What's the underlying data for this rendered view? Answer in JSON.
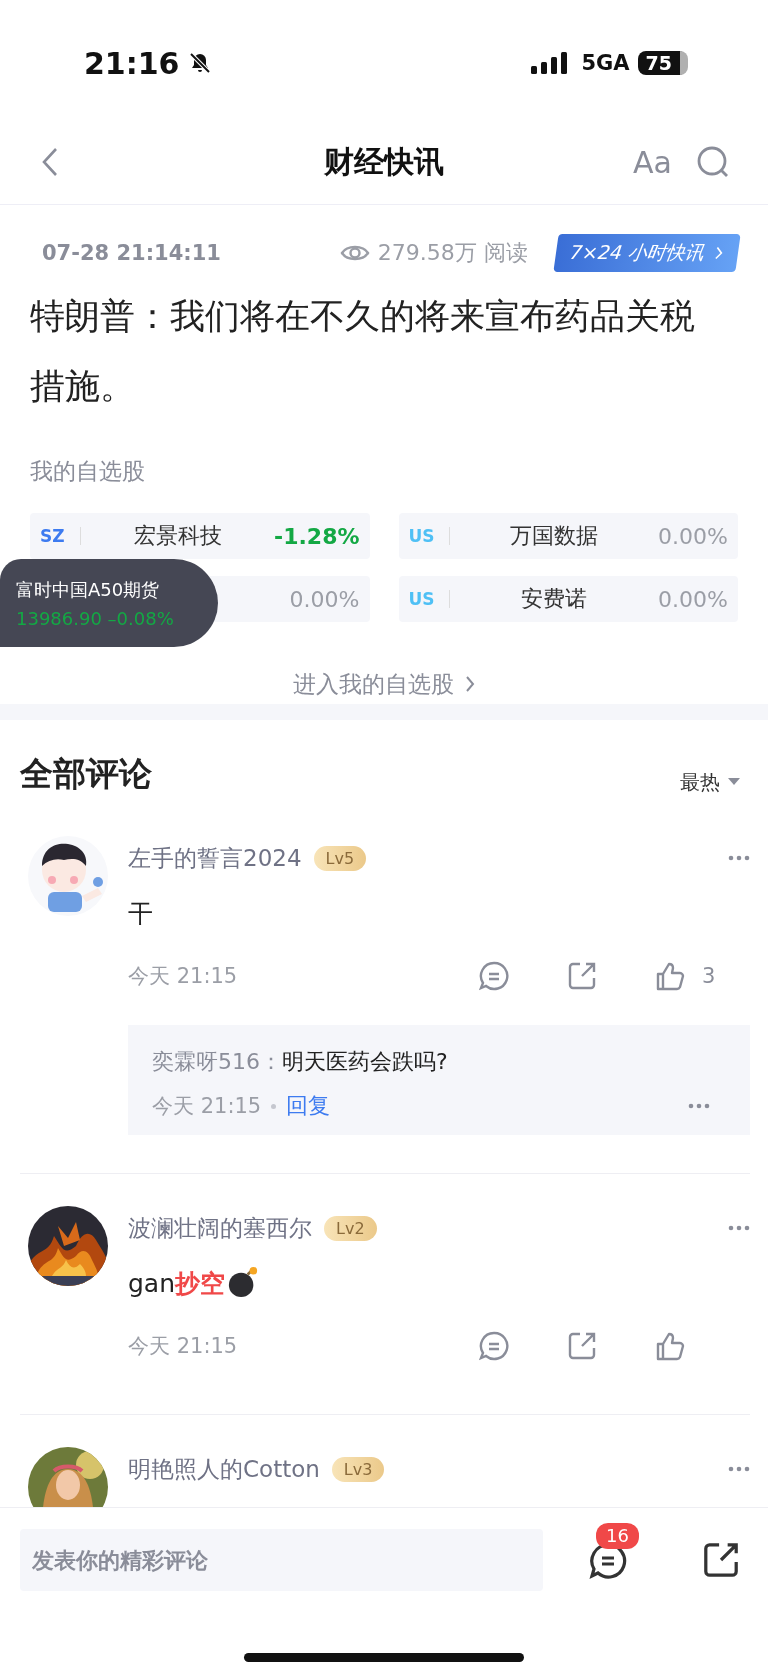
{
  "status_bar": {
    "time": "21:16",
    "network": "5GA",
    "battery": "75"
  },
  "header": {
    "title": "财经快讯",
    "font_button": "Aa"
  },
  "meta": {
    "datetime": "07-28 21:14:11",
    "views": "279.58万 阅读",
    "channel_button": "7×24 小时快讯"
  },
  "headline": "特朗普：我们将在不久的将来宣布药品关税措施。",
  "watchlist": {
    "title": "我的自选股",
    "stocks": [
      {
        "market": {
          "symbol": "SZ",
          "color": "#3d7bf0"
        },
        "name": "宏景科技",
        "change": "-1.28%",
        "color": "#13a844"
      },
      {
        "market": {
          "symbol": "US",
          "color": "#4fc0f5"
        },
        "name": "万国数据",
        "change": "0.00%",
        "color": "#9b9ea6"
      },
      {
        "change": "0.00%",
        "color": "#9b9ea6"
      },
      {
        "market": {
          "symbol": "US",
          "color": "#4fc0f5"
        },
        "name": "安费诺",
        "change": "0.00%",
        "color": "#9b9ea6"
      }
    ],
    "link": "进入我的自选股"
  },
  "float_quote": {
    "name": "富时中国A50期货",
    "quote": "13986.90 –0.08%",
    "color": "#13a844"
  },
  "comments": {
    "title": "全部评论",
    "sort": "最热",
    "items": [
      {
        "user": "左手的誓言2024",
        "level": "Lv5",
        "text": "干",
        "time": "今天 21:15",
        "likes": "3",
        "replies": [
          {
            "user": "奕霖呀516：",
            "text": "明天医药会跌吗?",
            "time": "今天 21:15",
            "action": "回复"
          }
        ]
      },
      {
        "user": "波澜壮阔的塞西尔",
        "level": "Lv2",
        "text": "gan**抄空**",
        "has_emoji": true,
        "time": "今天 21:15"
      },
      {
        "user": "明艳照人的Cotton",
        "level": "Lv3"
      }
    ]
  },
  "composer": {
    "placeholder": "发表你的精彩评论",
    "comment_count": "16"
  }
}
